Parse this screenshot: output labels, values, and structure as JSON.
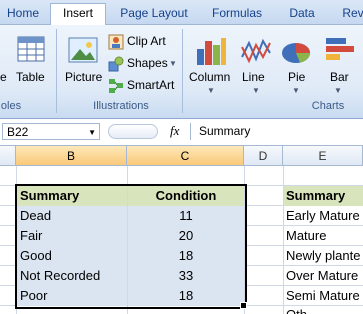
{
  "ribbon": {
    "tabs": [
      {
        "label": "Home"
      },
      {
        "label": "Insert"
      },
      {
        "label": "Page Layout"
      },
      {
        "label": "Formulas"
      },
      {
        "label": "Data"
      },
      {
        "label": "Rev"
      }
    ],
    "active_tab": "Insert",
    "groups": {
      "tables": {
        "label": "oles",
        "buttons": {
          "table_partial": "e",
          "table": "Table"
        }
      },
      "illustrations": {
        "label": "Illustrations",
        "buttons": {
          "picture": "Picture",
          "clip_art": "Clip Art",
          "shapes": "Shapes",
          "smartart": "SmartArt"
        }
      },
      "charts": {
        "label": "Charts",
        "buttons": {
          "column": "Column",
          "line": "Line",
          "pie": "Pie",
          "bar": "Bar"
        }
      }
    }
  },
  "formula_bar": {
    "name_box": "B22",
    "fx": "fx",
    "content": "Summary"
  },
  "columns": [
    "B",
    "C",
    "D",
    "E"
  ],
  "selected_columns": [
    "B",
    "C"
  ],
  "table": {
    "headers": [
      "Summary",
      "Condition"
    ],
    "rows": [
      [
        "Dead",
        "11"
      ],
      [
        "Fair",
        "20"
      ],
      [
        "Good",
        "18"
      ],
      [
        "Not Recorded",
        "33"
      ],
      [
        "Poor",
        "18"
      ]
    ]
  },
  "column_e": {
    "header": "Summary",
    "values": [
      "Early Mature",
      "Mature",
      "Newly plante",
      "Over Mature",
      "Semi Mature",
      "Oth"
    ]
  },
  "colors": {
    "header_fill": "#d8e4bc",
    "data_fill": "#dbe5f1",
    "accent": "#15428b"
  }
}
